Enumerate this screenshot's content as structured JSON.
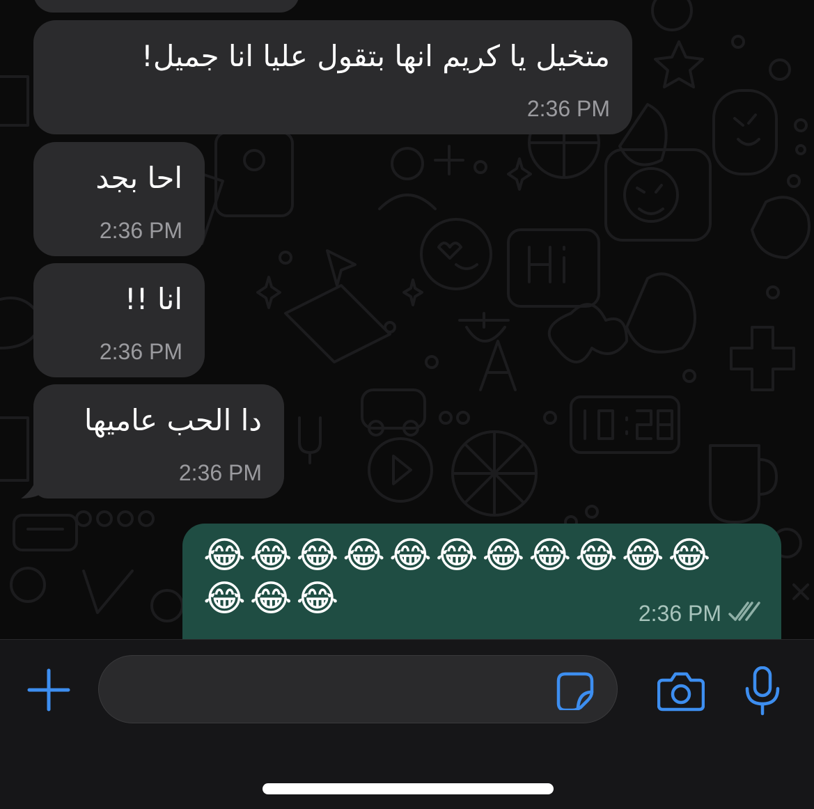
{
  "messages": [
    {
      "text": "متخيل يا كريم انها بتقول عليا انا جميل!",
      "time": "2:36 PM",
      "direction": "incoming"
    },
    {
      "text": "احا بجد",
      "time": "2:36 PM",
      "direction": "incoming"
    },
    {
      "text": "انا !!",
      "time": "2:36 PM",
      "direction": "incoming"
    },
    {
      "text": "دا الحب عاميها",
      "time": "2:36 PM",
      "direction": "incoming"
    },
    {
      "emoji_line_1": "😂😂😂😂😂😂😂😂😂😂😂",
      "emoji_line_2": "😂😂😂",
      "time": "2:36 PM",
      "direction": "outgoing",
      "status": "read"
    }
  ],
  "composer": {
    "placeholder": "",
    "icons": [
      "plus-icon",
      "sticker-icon",
      "camera-icon",
      "microphone-icon"
    ]
  },
  "colors": {
    "incoming_bubble": "#2b2b2d",
    "outgoing_bubble": "#1f4d43",
    "accent": "#3d8ef0"
  }
}
